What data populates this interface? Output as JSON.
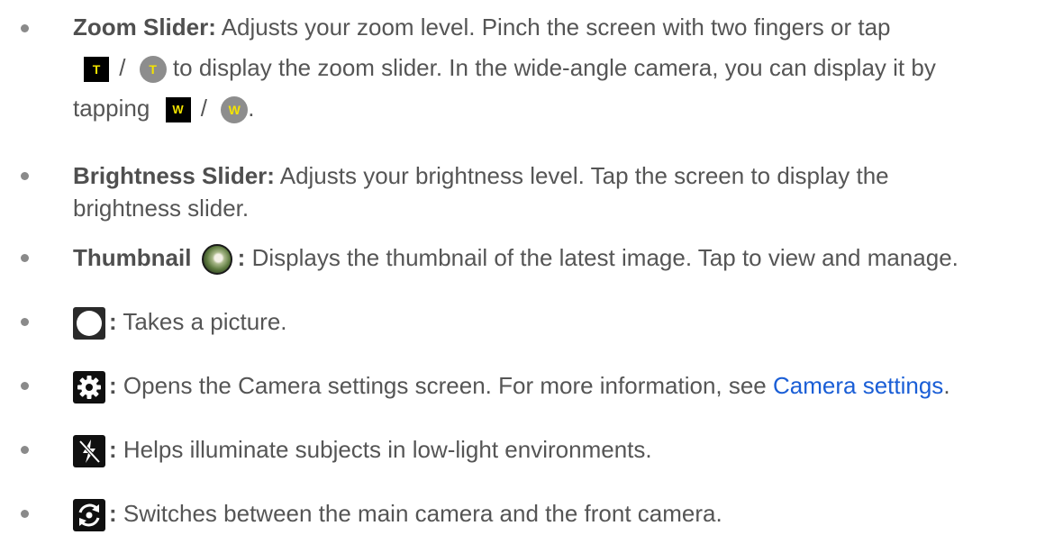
{
  "items": [
    {
      "title": "Zoom Slider:",
      "line1": " Adjusts your zoom level. Pinch the screen with two fingers or tap",
      "icon_t_square": "T",
      "slash_1": "/",
      "icon_t_circle": "T",
      "line2": " to display the zoom slider. In the wide-angle camera, you can display it by",
      "line3_pre": "tapping",
      "icon_w_square": "W",
      "slash_2": "/",
      "icon_w_circle": "W",
      "line3_post": "."
    },
    {
      "title": "Brightness Slider:",
      "line1": " Adjusts your brightness level. Tap the screen to display the",
      "line2": "brightness slider."
    },
    {
      "title": "Thumbnail",
      "colon": ":",
      "text": " Displays the thumbnail of the latest image. Tap to view and manage."
    },
    {
      "colon": ":",
      "text": " Takes a picture."
    },
    {
      "colon": ":",
      "text": " Opens the Camera settings screen. For more information, see ",
      "link": "Camera settings",
      "end": "."
    },
    {
      "colon": ":",
      "text": " Helps illuminate subjects in low-light environments."
    },
    {
      "colon": ":",
      "text": " Switches between the main camera and the front camera."
    }
  ],
  "icons": {
    "zoom_tele": "zoom-tele-icon",
    "zoom_wide": "zoom-wide-icon",
    "thumbnail": "thumbnail-icon",
    "shutter": "shutter-icon",
    "settings": "gear-icon",
    "flash": "flash-off-icon",
    "switch_camera": "switch-camera-icon"
  },
  "colors": {
    "link": "#1a5ed6",
    "icon_yellow": "#f5e400"
  }
}
